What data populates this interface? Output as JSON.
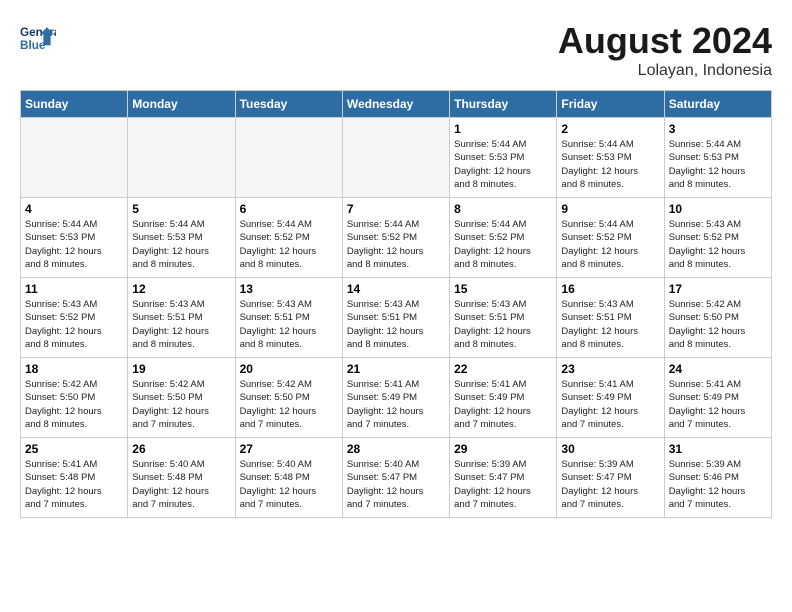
{
  "header": {
    "logo_line1": "General",
    "logo_line2": "Blue",
    "month_year": "August 2024",
    "location": "Lolayan, Indonesia"
  },
  "days_of_week": [
    "Sunday",
    "Monday",
    "Tuesday",
    "Wednesday",
    "Thursday",
    "Friday",
    "Saturday"
  ],
  "weeks": [
    [
      {
        "day": "",
        "info": ""
      },
      {
        "day": "",
        "info": ""
      },
      {
        "day": "",
        "info": ""
      },
      {
        "day": "",
        "info": ""
      },
      {
        "day": "1",
        "info": "Sunrise: 5:44 AM\nSunset: 5:53 PM\nDaylight: 12 hours\nand 8 minutes."
      },
      {
        "day": "2",
        "info": "Sunrise: 5:44 AM\nSunset: 5:53 PM\nDaylight: 12 hours\nand 8 minutes."
      },
      {
        "day": "3",
        "info": "Sunrise: 5:44 AM\nSunset: 5:53 PM\nDaylight: 12 hours\nand 8 minutes."
      }
    ],
    [
      {
        "day": "4",
        "info": "Sunrise: 5:44 AM\nSunset: 5:53 PM\nDaylight: 12 hours\nand 8 minutes."
      },
      {
        "day": "5",
        "info": "Sunrise: 5:44 AM\nSunset: 5:53 PM\nDaylight: 12 hours\nand 8 minutes."
      },
      {
        "day": "6",
        "info": "Sunrise: 5:44 AM\nSunset: 5:52 PM\nDaylight: 12 hours\nand 8 minutes."
      },
      {
        "day": "7",
        "info": "Sunrise: 5:44 AM\nSunset: 5:52 PM\nDaylight: 12 hours\nand 8 minutes."
      },
      {
        "day": "8",
        "info": "Sunrise: 5:44 AM\nSunset: 5:52 PM\nDaylight: 12 hours\nand 8 minutes."
      },
      {
        "day": "9",
        "info": "Sunrise: 5:44 AM\nSunset: 5:52 PM\nDaylight: 12 hours\nand 8 minutes."
      },
      {
        "day": "10",
        "info": "Sunrise: 5:43 AM\nSunset: 5:52 PM\nDaylight: 12 hours\nand 8 minutes."
      }
    ],
    [
      {
        "day": "11",
        "info": "Sunrise: 5:43 AM\nSunset: 5:52 PM\nDaylight: 12 hours\nand 8 minutes."
      },
      {
        "day": "12",
        "info": "Sunrise: 5:43 AM\nSunset: 5:51 PM\nDaylight: 12 hours\nand 8 minutes."
      },
      {
        "day": "13",
        "info": "Sunrise: 5:43 AM\nSunset: 5:51 PM\nDaylight: 12 hours\nand 8 minutes."
      },
      {
        "day": "14",
        "info": "Sunrise: 5:43 AM\nSunset: 5:51 PM\nDaylight: 12 hours\nand 8 minutes."
      },
      {
        "day": "15",
        "info": "Sunrise: 5:43 AM\nSunset: 5:51 PM\nDaylight: 12 hours\nand 8 minutes."
      },
      {
        "day": "16",
        "info": "Sunrise: 5:43 AM\nSunset: 5:51 PM\nDaylight: 12 hours\nand 8 minutes."
      },
      {
        "day": "17",
        "info": "Sunrise: 5:42 AM\nSunset: 5:50 PM\nDaylight: 12 hours\nand 8 minutes."
      }
    ],
    [
      {
        "day": "18",
        "info": "Sunrise: 5:42 AM\nSunset: 5:50 PM\nDaylight: 12 hours\nand 8 minutes."
      },
      {
        "day": "19",
        "info": "Sunrise: 5:42 AM\nSunset: 5:50 PM\nDaylight: 12 hours\nand 7 minutes."
      },
      {
        "day": "20",
        "info": "Sunrise: 5:42 AM\nSunset: 5:50 PM\nDaylight: 12 hours\nand 7 minutes."
      },
      {
        "day": "21",
        "info": "Sunrise: 5:41 AM\nSunset: 5:49 PM\nDaylight: 12 hours\nand 7 minutes."
      },
      {
        "day": "22",
        "info": "Sunrise: 5:41 AM\nSunset: 5:49 PM\nDaylight: 12 hours\nand 7 minutes."
      },
      {
        "day": "23",
        "info": "Sunrise: 5:41 AM\nSunset: 5:49 PM\nDaylight: 12 hours\nand 7 minutes."
      },
      {
        "day": "24",
        "info": "Sunrise: 5:41 AM\nSunset: 5:49 PM\nDaylight: 12 hours\nand 7 minutes."
      }
    ],
    [
      {
        "day": "25",
        "info": "Sunrise: 5:41 AM\nSunset: 5:48 PM\nDaylight: 12 hours\nand 7 minutes."
      },
      {
        "day": "26",
        "info": "Sunrise: 5:40 AM\nSunset: 5:48 PM\nDaylight: 12 hours\nand 7 minutes."
      },
      {
        "day": "27",
        "info": "Sunrise: 5:40 AM\nSunset: 5:48 PM\nDaylight: 12 hours\nand 7 minutes."
      },
      {
        "day": "28",
        "info": "Sunrise: 5:40 AM\nSunset: 5:47 PM\nDaylight: 12 hours\nand 7 minutes."
      },
      {
        "day": "29",
        "info": "Sunrise: 5:39 AM\nSunset: 5:47 PM\nDaylight: 12 hours\nand 7 minutes."
      },
      {
        "day": "30",
        "info": "Sunrise: 5:39 AM\nSunset: 5:47 PM\nDaylight: 12 hours\nand 7 minutes."
      },
      {
        "day": "31",
        "info": "Sunrise: 5:39 AM\nSunset: 5:46 PM\nDaylight: 12 hours\nand 7 minutes."
      }
    ]
  ]
}
